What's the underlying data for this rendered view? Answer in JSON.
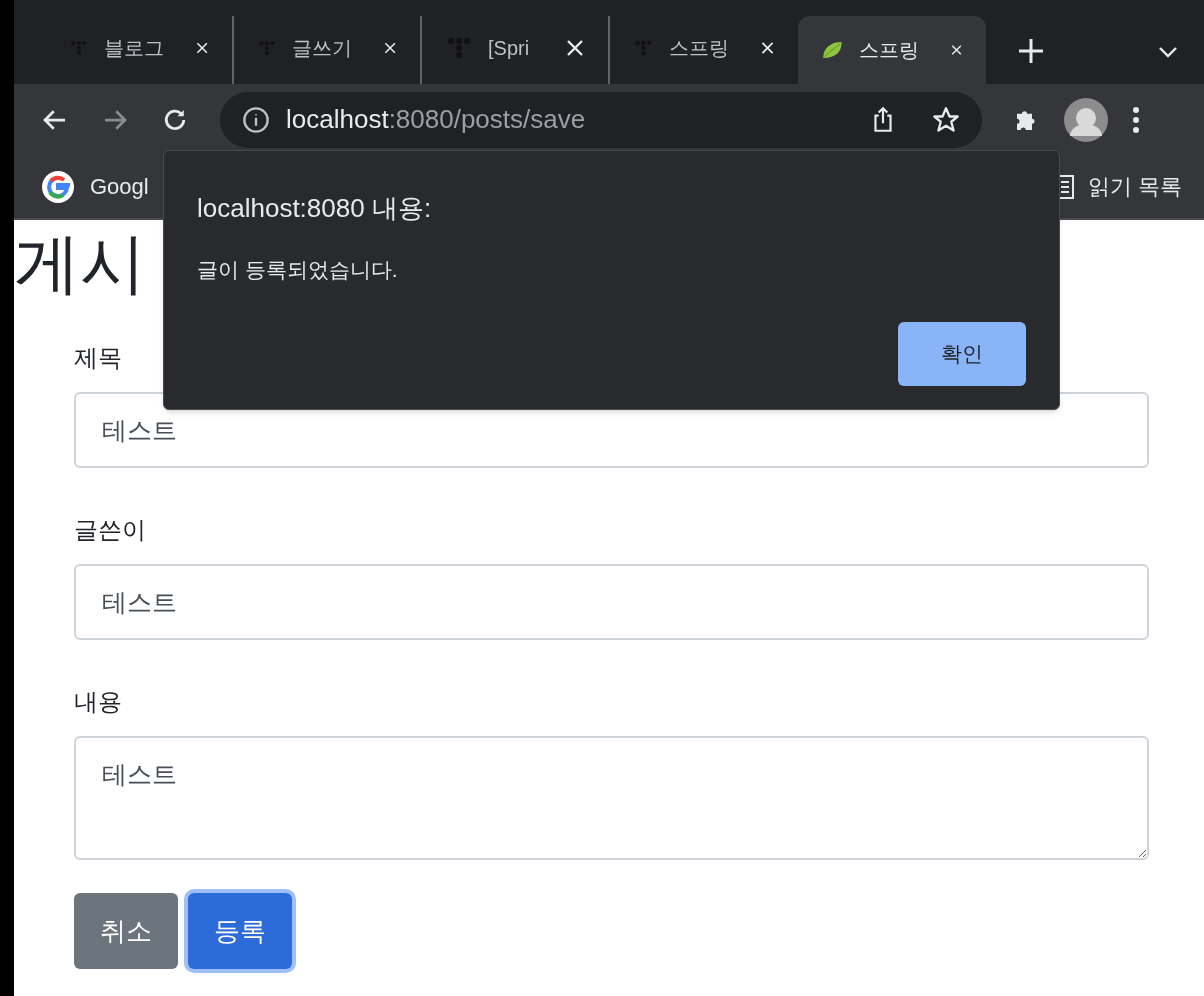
{
  "tabs": [
    {
      "title": "블로그",
      "kind": "dots",
      "selected": false
    },
    {
      "title": "글쓰기",
      "kind": "dots",
      "selected": false
    },
    {
      "title": "[Spri",
      "kind": "dots",
      "selected": false
    },
    {
      "title": "스프링",
      "kind": "dots",
      "selected": false
    },
    {
      "title": "스프링",
      "kind": "leaf",
      "selected": true
    }
  ],
  "address_bar": {
    "host": "localhost",
    "path": ":8080/posts/save"
  },
  "bookmarks": [
    {
      "label": "Googl",
      "kind": "google"
    }
  ],
  "reading_list": "읽기 목록",
  "page": {
    "heading": "게시",
    "fields": [
      {
        "label": "제목",
        "value": "테스트",
        "kind": "input"
      },
      {
        "label": "글쓴이",
        "value": "테스트",
        "kind": "input"
      },
      {
        "label": "내용",
        "value": "테스트",
        "kind": "textarea"
      }
    ],
    "buttons": [
      {
        "label": "취소",
        "kind": "secondary",
        "focused": false
      },
      {
        "label": "등록",
        "kind": "primary",
        "focused": true
      }
    ]
  },
  "dialog": {
    "title": "localhost:8080 내용:",
    "message": "글이 등록되었습니다.",
    "button": "확인"
  }
}
